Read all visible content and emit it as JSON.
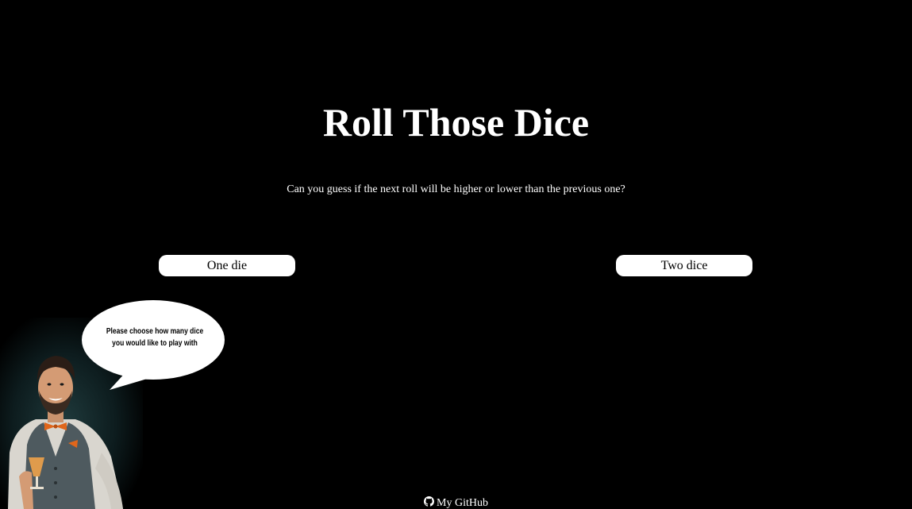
{
  "header": {
    "title": "Roll Those Dice",
    "subtitle": "Can you guess if the next roll will be higher or lower than the previous one?"
  },
  "choices": {
    "one_die_label": "One die",
    "two_dice_label": "Two dice"
  },
  "mascot": {
    "speech": "Please choose how many dice you would like to play with"
  },
  "footer": {
    "github_label": "My GitHub",
    "icon": "github-icon"
  },
  "colors": {
    "background": "#000000",
    "text": "#ffffff",
    "button_bg": "#ffffff",
    "button_text": "#000000",
    "bowtie": "#e0661b"
  }
}
